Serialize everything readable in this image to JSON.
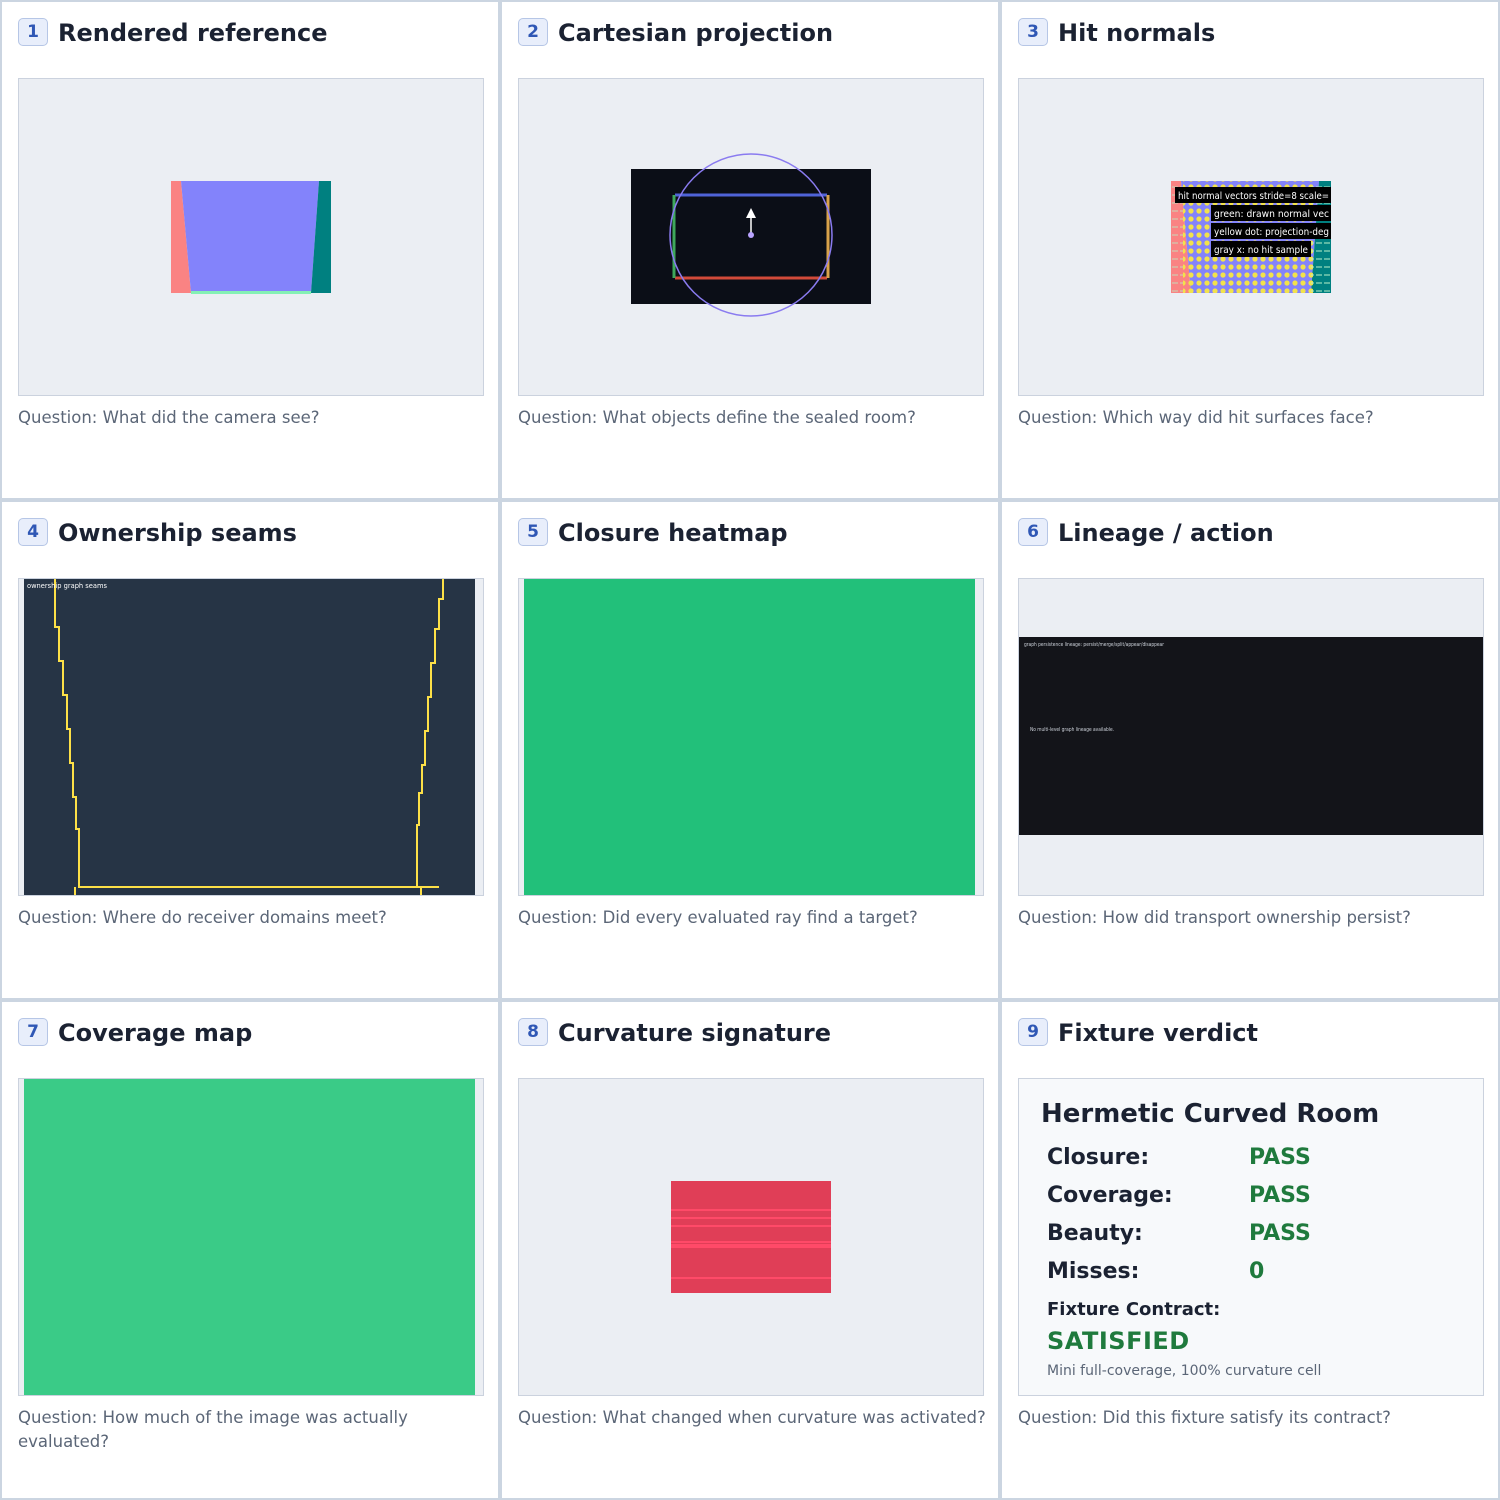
{
  "panels": [
    {
      "num": "1",
      "title": "Rendered reference",
      "question": "Question: What did the camera see?"
    },
    {
      "num": "2",
      "title": "Cartesian projection",
      "question": "Question: What objects define the sealed room?"
    },
    {
      "num": "3",
      "title": "Hit normals",
      "question": "Question: Which way did hit surfaces face?"
    },
    {
      "num": "4",
      "title": "Ownership seams",
      "question": "Question: Where do receiver domains meet?"
    },
    {
      "num": "5",
      "title": "Closure heatmap",
      "question": "Question: Did every evaluated ray find a target?"
    },
    {
      "num": "6",
      "title": "Lineage / action",
      "question": "Question: How did transport ownership persist?"
    },
    {
      "num": "7",
      "title": "Coverage map",
      "question": "Question: How much of the image was actually evaluated?"
    },
    {
      "num": "8",
      "title": "Curvature signature",
      "question": "Question: What changed when curvature was activated?"
    },
    {
      "num": "9",
      "title": "Fixture verdict",
      "question": "Question: Did this fixture satisfy its contract?"
    }
  ],
  "hit_normals": {
    "legend": [
      "hit normal vectors stride=8 scale=",
      "green: drawn normal vec",
      "yellow dot: projection-deg",
      "gray x: no hit sample"
    ]
  },
  "ownership": {
    "label": "ownership graph seams"
  },
  "lineage": {
    "header": "graph persistence lineage: persist/merge/split/appear/disappear",
    "empty": "No multi-level graph lineage available."
  },
  "verdict": {
    "title": "Hermetic Curved Room",
    "rows": [
      {
        "label": "Closure:",
        "value": "PASS"
      },
      {
        "label": "Coverage:",
        "value": "PASS"
      },
      {
        "label": "Beauty:",
        "value": "PASS"
      },
      {
        "label": "Misses:",
        "value": "0"
      }
    ],
    "contract_label": "Fixture Contract:",
    "contract_value": "SATISFIED",
    "note": "Mini full-coverage, 100% curvature cell"
  },
  "colors": {
    "accent_blue": "#2f57b5",
    "pass_green": "#1f7a3d",
    "closure_green": "#22c07a",
    "coverage_green": "#3acb87",
    "seam_yellow": "#fde047",
    "seam_bg": "#263445",
    "curvature_red": "#e03e57"
  }
}
